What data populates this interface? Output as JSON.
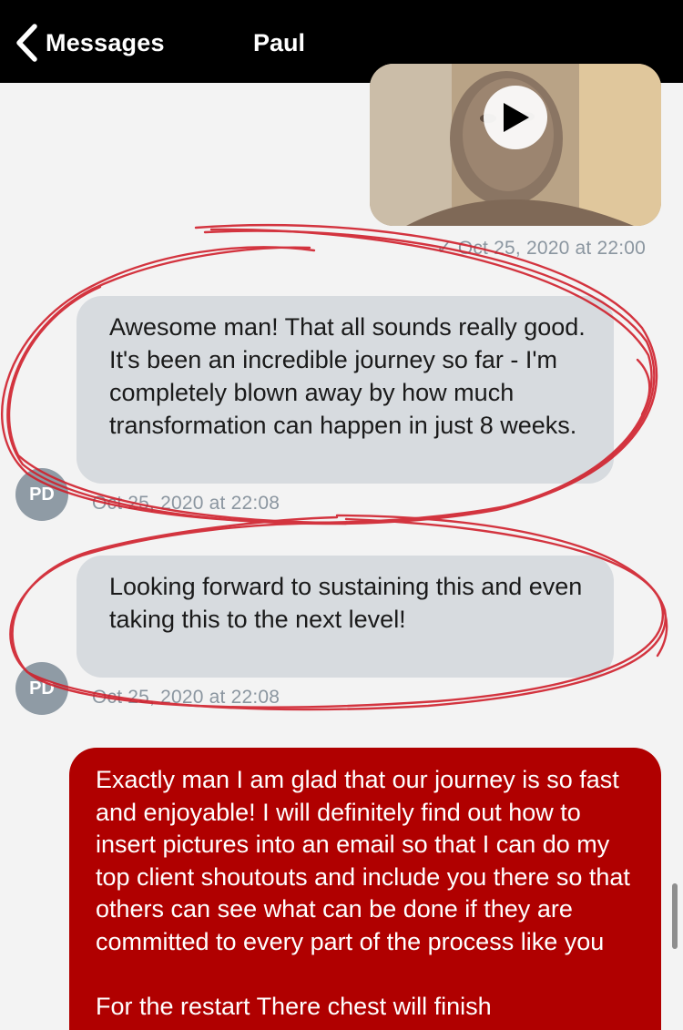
{
  "navbar": {
    "back_label": "Messages",
    "contact_name": "Paul",
    "back_icon": "chevron-left-icon"
  },
  "video": {
    "play_icon": "play-icon"
  },
  "messages": [
    {
      "timestamp": "✓ Oct 25, 2020 at 22:00"
    },
    {
      "direction": "incoming",
      "avatar_initials": "PD",
      "text": "Awesome man!  That all sounds really good.  It's been an incredible journey so far - I'm completely blown away by how much transformation can happen in just 8 weeks.",
      "timestamp": "Oct 25, 2020 at 22:08"
    },
    {
      "direction": "incoming",
      "avatar_initials": "PD",
      "text": "Looking forward to sustaining this and even taking this to the next level!",
      "timestamp": "Oct 25, 2020 at 22:08"
    },
    {
      "direction": "outgoing",
      "text": "Exactly man I am glad that our journey is so fast and enjoyable! I will definitely find out how to insert pictures into an email so that I can do my top client shoutouts and include you there so that others can see what can be done if they are committed to every part of the process like you\n\nFor the restart There chest will finish"
    }
  ],
  "colors": {
    "navbar_bg": "#000000",
    "incoming_bubble": "#d7dbdf",
    "outgoing_bubble": "#b00000",
    "annotation": "#d0202c"
  }
}
